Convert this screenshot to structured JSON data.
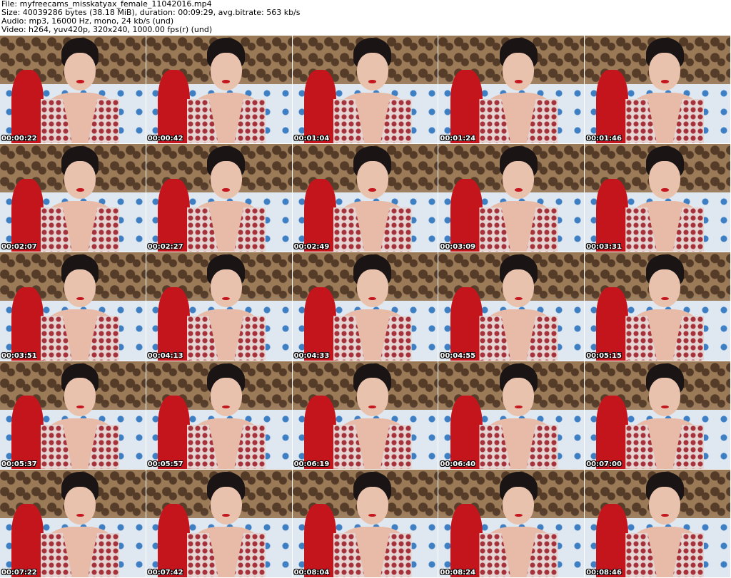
{
  "header": {
    "file": "File: myfreecams_misskatyax_female_11042016.mp4",
    "size": "Size: 40039286 bytes (38.18 MiB), duration: 00:09:29, avg.bitrate: 563 kb/s",
    "audio": "Audio: mp3, 16000 Hz, mono, 24 kb/s (und)",
    "video": "Video: h264, yuv420p, 320x240, 1000.00 fps(r) (und)"
  },
  "thumbnails": [
    {
      "timestamp": "00:00:22"
    },
    {
      "timestamp": "00:00:42"
    },
    {
      "timestamp": "00:01:04"
    },
    {
      "timestamp": "00:01:24"
    },
    {
      "timestamp": "00:01:46"
    },
    {
      "timestamp": "00:02:07"
    },
    {
      "timestamp": "00:02:27"
    },
    {
      "timestamp": "00:02:49"
    },
    {
      "timestamp": "00:03:09"
    },
    {
      "timestamp": "00:03:31"
    },
    {
      "timestamp": "00:03:51"
    },
    {
      "timestamp": "00:04:13"
    },
    {
      "timestamp": "00:04:33"
    },
    {
      "timestamp": "00:04:55"
    },
    {
      "timestamp": "00:05:15"
    },
    {
      "timestamp": "00:05:37"
    },
    {
      "timestamp": "00:05:57"
    },
    {
      "timestamp": "00:06:19"
    },
    {
      "timestamp": "00:06:40"
    },
    {
      "timestamp": "00:07:00"
    },
    {
      "timestamp": "00:07:22"
    },
    {
      "timestamp": "00:07:42"
    },
    {
      "timestamp": "00:08:04"
    },
    {
      "timestamp": "00:08:24"
    },
    {
      "timestamp": "00:08:46"
    }
  ]
}
